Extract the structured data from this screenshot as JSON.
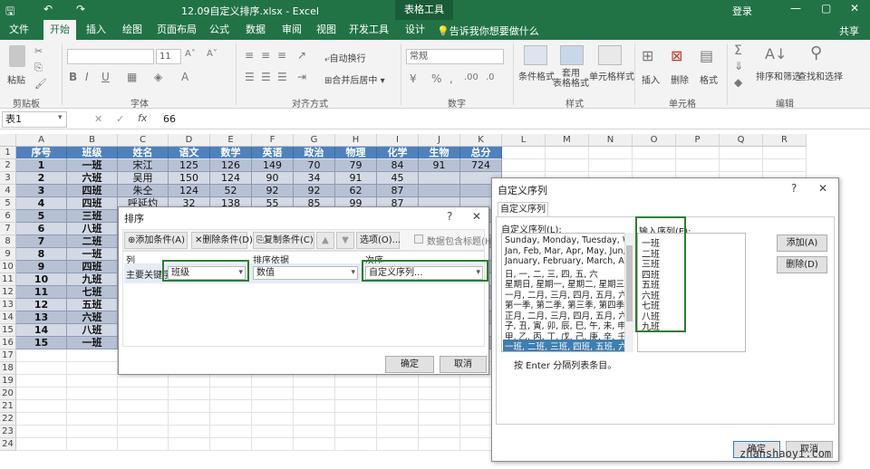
{
  "titlebar": {
    "title": "12.09自定义排序.xlsx  -  Excel",
    "table_tools": "表格工具",
    "login": "登录",
    "qa_save": "🖫",
    "qa_undo": "↶",
    "qa_redo": "↷",
    "win_min": "—",
    "win_max": "▢",
    "win_close": "✕"
  },
  "tabs": [
    "文件",
    "开始",
    "插入",
    "绘图",
    "页面布局",
    "公式",
    "数据",
    "审阅",
    "视图",
    "开发工具",
    "设计"
  ],
  "tellme": "告诉我你想要做什么",
  "share": "共享",
  "ribbon": {
    "paste": "粘贴",
    "groups": [
      "剪贴板",
      "字体",
      "对齐方式",
      "数字",
      "样式",
      "单元格",
      "编辑"
    ],
    "font_size": "11",
    "wrap": "自动换行",
    "merge": "合并后居中",
    "number_format": "常规",
    "cond_format": "条件格式",
    "table_format": "套用\n表格格式",
    "cell_style": "单元格样式",
    "insert": "插入",
    "delete": "删除",
    "format": "格式",
    "sort_filter": "排序和筛选",
    "find_select": "查找和选择"
  },
  "formula_bar": {
    "name": "表1",
    "value": "66",
    "fx": "fx",
    "cancel": "✕",
    "enter": "✓"
  },
  "columns": [
    "A",
    "B",
    "C",
    "D",
    "E",
    "F",
    "G",
    "H",
    "I",
    "J",
    "K",
    "L",
    "M",
    "N",
    "O",
    "P",
    "Q",
    "R"
  ],
  "rows": [
    "1",
    "2",
    "3",
    "4",
    "5",
    "6",
    "7",
    "8",
    "9",
    "10",
    "11",
    "12",
    "13",
    "14",
    "15",
    "16",
    "17",
    "18",
    "19",
    "20",
    "21",
    "22",
    "23",
    "24"
  ],
  "table": {
    "headers": [
      "序号",
      "班级",
      "姓名",
      "语文",
      "数学",
      "英语",
      "政治",
      "物理",
      "化学",
      "生物",
      "总分"
    ],
    "data": [
      [
        "1",
        "一班",
        "宋江",
        "125",
        "126",
        "149",
        "70",
        "79",
        "84",
        "91",
        "724"
      ],
      [
        "2",
        "六班",
        "吴用",
        "150",
        "124",
        "90",
        "34",
        "91",
        "45",
        "",
        ""
      ],
      [
        "3",
        "四班",
        "朱仝",
        "124",
        "52",
        "92",
        "92",
        "62",
        "87",
        "",
        ""
      ],
      [
        "4",
        "四班",
        "呼延灼",
        "32",
        "138",
        "55",
        "85",
        "99",
        "87",
        "",
        ""
      ],
      [
        "5",
        "三班",
        "",
        "",
        "",
        "",
        "",
        "",
        "",
        "",
        ""
      ],
      [
        "6",
        "八班",
        "",
        "",
        "",
        "",
        "",
        "",
        "",
        "",
        ""
      ],
      [
        "7",
        "二班",
        "",
        "",
        "",
        "",
        "",
        "",
        "",
        "",
        ""
      ],
      [
        "8",
        "一班",
        "",
        "",
        "",
        "",
        "",
        "",
        "",
        "",
        ""
      ],
      [
        "9",
        "四班",
        "",
        "",
        "",
        "",
        "",
        "",
        "",
        "",
        ""
      ],
      [
        "10",
        "九班",
        "",
        "",
        "",
        "",
        "",
        "",
        "",
        "",
        ""
      ],
      [
        "11",
        "七班",
        "",
        "",
        "",
        "",
        "",
        "",
        "",
        "",
        ""
      ],
      [
        "12",
        "五班",
        "",
        "",
        "",
        "",
        "",
        "",
        "",
        "",
        ""
      ],
      [
        "13",
        "六班",
        "",
        "",
        "",
        "",
        "",
        "",
        "",
        "",
        ""
      ],
      [
        "14",
        "八班",
        "",
        "",
        "",
        "",
        "",
        "",
        "",
        "",
        ""
      ],
      [
        "15",
        "一班",
        "",
        "",
        "",
        "",
        "",
        "",
        "",
        "",
        ""
      ]
    ]
  },
  "sort_dialog": {
    "title": "排序",
    "help": "?",
    "close": "✕",
    "add": "添加条件(A)",
    "delete": "删除条件(D)",
    "copy": "复制条件(C)",
    "up": "▲",
    "down": "▼",
    "options": "选项(O)...",
    "has_header": "数据包含标题(H)",
    "col_header": "列",
    "by_header": "排序依据",
    "order_header": "次序",
    "key_label": "主要关键字",
    "key_value": "班级",
    "by_value": "数值",
    "order_value": "自定义序列...",
    "ok": "确定",
    "cancel": "取消"
  },
  "custom_dialog": {
    "title": "自定义序列",
    "help": "?",
    "close": "✕",
    "tab": "自定义序列",
    "lists_label": "自定义序列(L):",
    "lists": [
      "Sunday, Monday, Tuesday, Wed",
      "Jan, Feb, Mar, Apr, May, Jun, Jul",
      "January, February, March, April,",
      "日, 一, 二, 三, 四, 五, 六",
      "星期日, 星期一, 星期二, 星期三, 星",
      "一月, 二月, 三月, 四月, 五月, 六月,",
      "第一季, 第二季, 第三季, 第四季",
      "正月, 二月, 三月, 四月, 五月, 六月,",
      "子, 丑, 寅, 卯, 辰, 巳, 午, 未, 申, 酉,",
      "甲, 乙, 丙, 丁, 戊, 己, 庚, 辛, 壬, 癸",
      "一班, 二班, 三班, 四班, 五班, 六班,"
    ],
    "entries_label": "输入序列(E):",
    "entries": [
      "一班",
      "二班",
      "三班",
      "四班",
      "五班",
      "六班",
      "七班",
      "八班",
      "九班"
    ],
    "add": "添加(A)",
    "delete": "删除(D)",
    "hint": "按 Enter 分隔列表条目。",
    "ok": "确定",
    "cancel": "取消"
  },
  "watermark": "zhanshaoyi.com",
  "colors": {
    "excel_green": "#217346",
    "table_header": "#4f81bd",
    "highlight": "#2e7d32"
  }
}
